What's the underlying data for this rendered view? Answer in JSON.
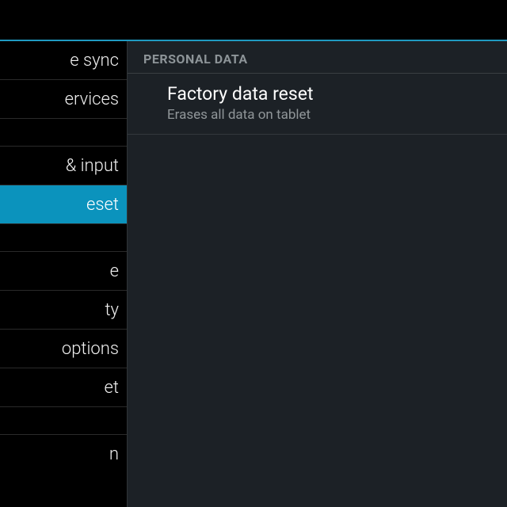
{
  "sidebar": {
    "items": [
      {
        "label": "e sync",
        "selected": false
      },
      {
        "label": "ervices",
        "selected": false
      }
    ],
    "items2": [
      {
        "label": "& input",
        "selected": false
      },
      {
        "label": "eset",
        "selected": true
      }
    ],
    "items3": [
      {
        "label": "e",
        "selected": false
      },
      {
        "label": "ty",
        "selected": false
      },
      {
        "label": "options",
        "selected": false
      },
      {
        "label": "et",
        "selected": false
      }
    ],
    "footer": {
      "label": "n"
    }
  },
  "main": {
    "section_header": "PERSONAL DATA",
    "rows": [
      {
        "title": "Factory data reset",
        "summary": "Erases all data on tablet"
      }
    ]
  },
  "colors": {
    "accent": "#0b93bd",
    "divider": "#1f9ac1",
    "main_bg": "#1c2126"
  }
}
